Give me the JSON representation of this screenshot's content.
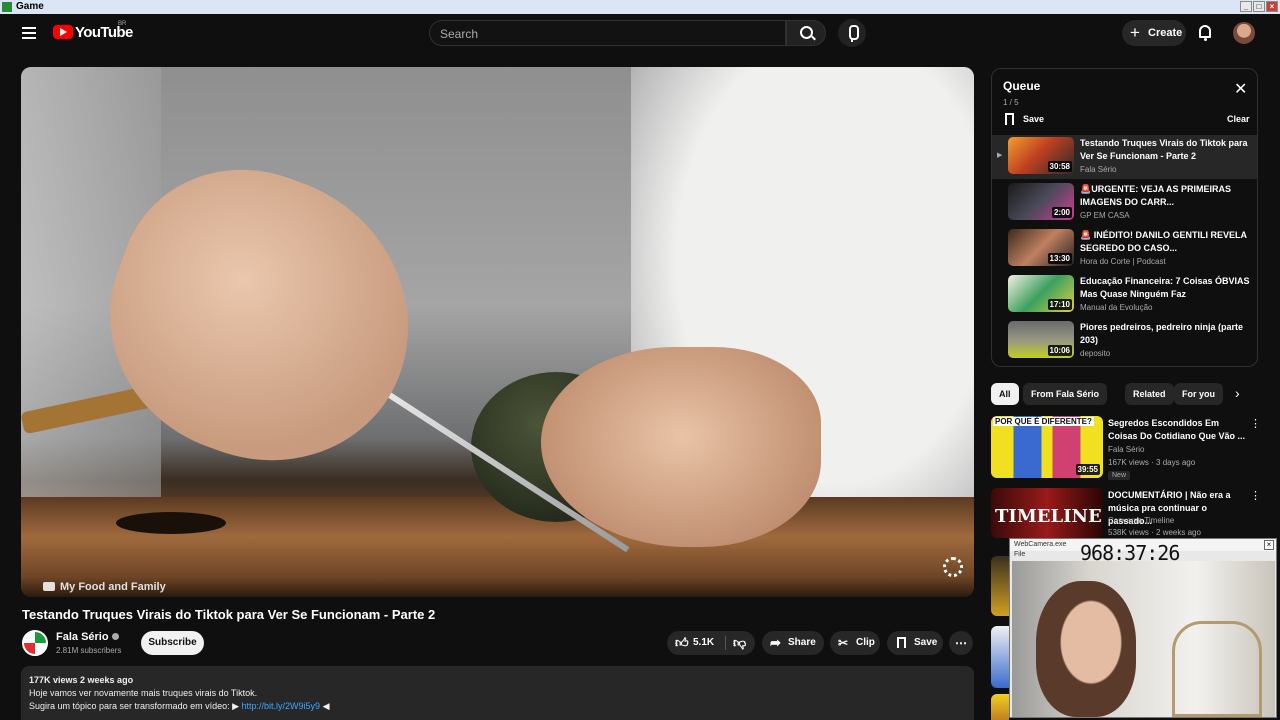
{
  "window": {
    "title": "Game",
    "buttons": [
      "_",
      "□",
      "×"
    ]
  },
  "header": {
    "logo_text": "YouTube",
    "region": "BR",
    "search_placeholder": "Search",
    "create_label": "Create",
    "icons": [
      "menu-icon",
      "search-icon",
      "mic-icon",
      "bell-icon",
      "avatar"
    ]
  },
  "player": {
    "watermark": "My Food and Family"
  },
  "video": {
    "title": "Testando Truques Virais do Tiktok para Ver Se Funcionam - Parte 2",
    "channel": "Fala Sério",
    "subscribers": "2.81M subscribers",
    "subscribe_label": "Subscribe",
    "likes": "5.1K",
    "share_label": "Share",
    "clip_label": "Clip",
    "save_label": "Save",
    "more_label": "⋯"
  },
  "description": {
    "meta": "177K views  2 weeks ago",
    "line1": "Hoje vamos ver novamente mais truques virais do Tiktok.",
    "line2_prefix": "Sugira um tópico para ser transformado em vídeo: ▶ ",
    "link": "http://bit.ly/2W9i5y9",
    "line2_suffix": " ◀"
  },
  "queue": {
    "title": "Queue",
    "count": "1 / 5",
    "save_label": "Save",
    "clear_label": "Clear",
    "items": [
      {
        "title": "Testando Truques Virais do Tiktok para Ver Se Funcionam - Parte 2",
        "channel": "Fala Sério",
        "duration": "30:58",
        "active": true
      },
      {
        "title": "🚨URGENTE: VEJA AS PRIMEIRAS IMAGENS DO CARR...",
        "channel": "GP EM CASA",
        "duration": "2:00",
        "active": false
      },
      {
        "title": "🚨 INÉDITO! DANILO GENTILI REVELA SEGREDO DO CASO...",
        "channel": "Hora do Corte | Podcast",
        "duration": "13:30",
        "active": false
      },
      {
        "title": "Educação Financeira: 7 Coisas ÓBVIAS Mas Quase Ninguém Faz",
        "channel": "Manual da Evolução",
        "duration": "17:10",
        "active": false
      },
      {
        "title": "Piores pedreiros, pedreiro ninja (parte 203)",
        "channel": "deposito",
        "duration": "10:06",
        "active": false
      }
    ]
  },
  "chips": [
    "All",
    "From Fala Sério",
    "Related",
    "For you"
  ],
  "recommendations": [
    {
      "title": "Segredos Escondidos Em Coisas Do Cotidiano Que Vão ...",
      "channel": "Fala Sério",
      "views": "167K views · 3 days ago",
      "duration": "39:55",
      "badge": "New",
      "thumb_text": "POR QUE É DIFERENTE?"
    },
    {
      "title": "DOCUMENTÁRIO | Não era a música pra continuar o passado...",
      "channel": "Conversa Timeline",
      "views": "538K views · 2 weeks ago",
      "duration": "",
      "badge": "",
      "thumb_text": "TIMELINE"
    }
  ],
  "camera_window": {
    "title": "WebCamera.exe",
    "menu": "File",
    "timer": "968:37:26"
  },
  "colors": {
    "background": "#0f0f0f",
    "accent": "#ff0000",
    "link": "#3ea6ff"
  }
}
